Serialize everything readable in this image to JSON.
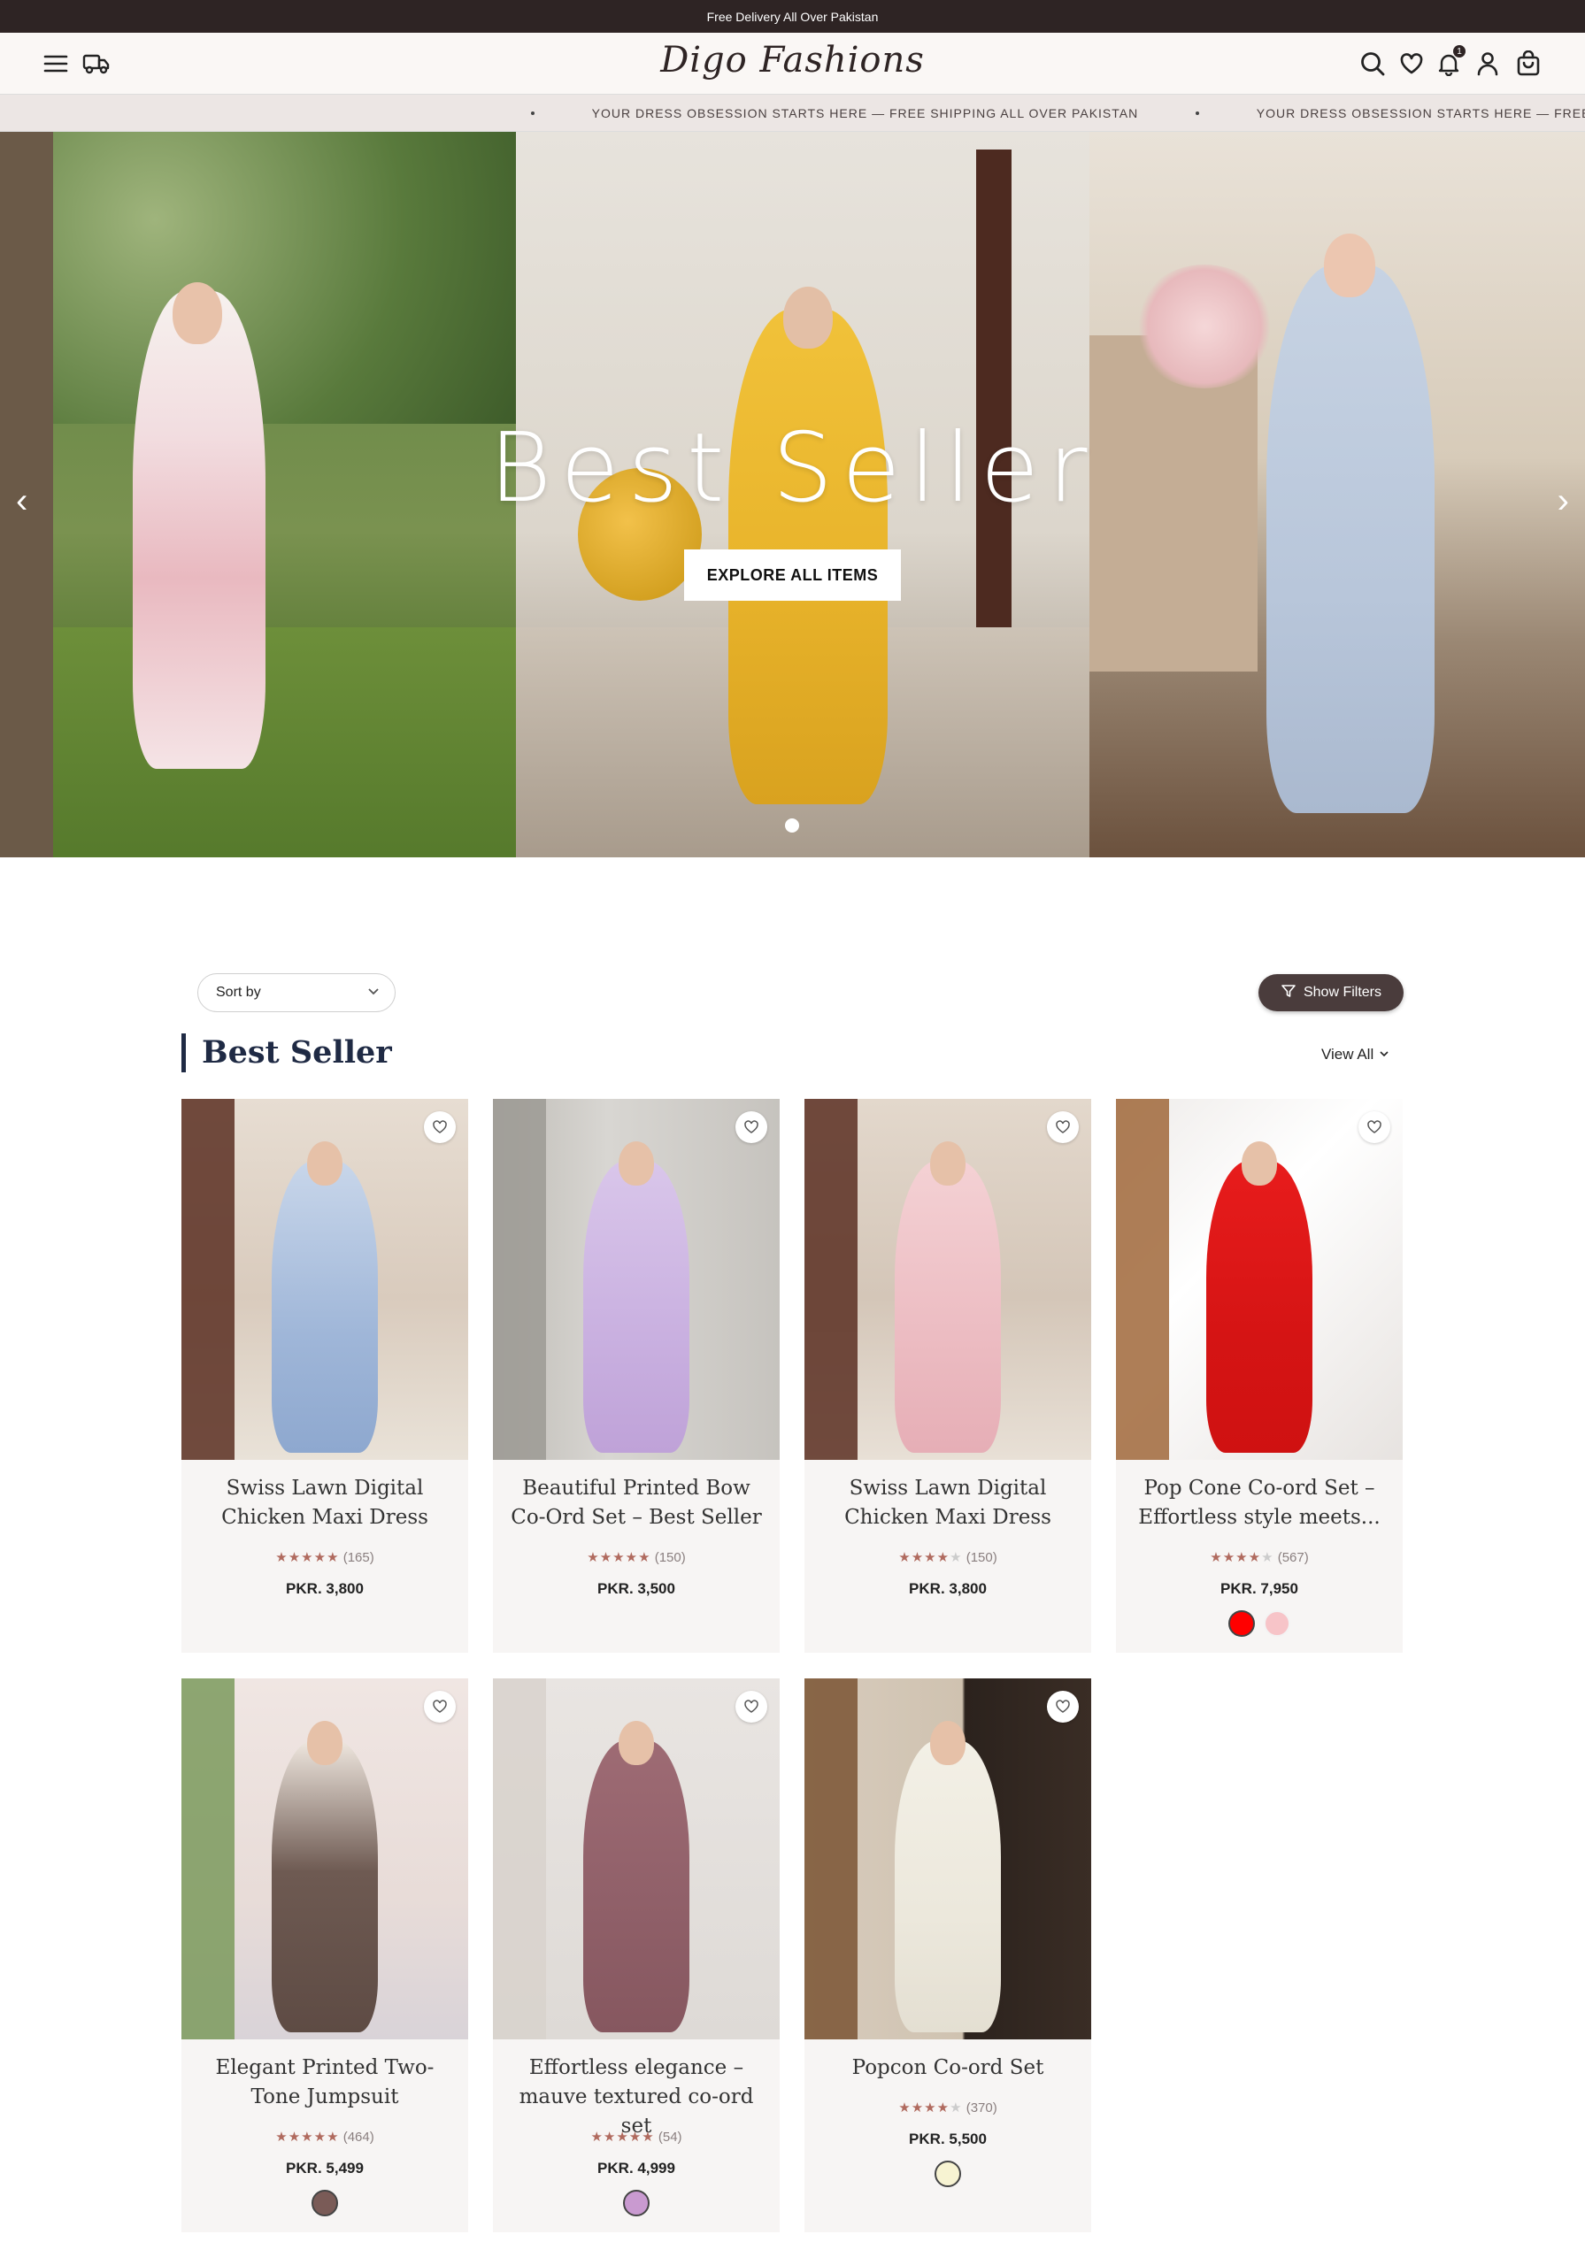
{
  "topbar": {
    "text": "Free Delivery All Over Pakistan"
  },
  "header": {
    "logo": "Digo Fashions",
    "notification_count": "1",
    "icons": [
      "menu-icon",
      "delivery-truck-icon",
      "search-icon",
      "heart-icon",
      "bell-icon",
      "user-icon",
      "cart-icon"
    ]
  },
  "marquee": {
    "text_1": "YOUR DRESS OBSESSION STARTS HERE — FREE SHIPPING ALL OVER PAKISTAN",
    "text_2": "YOUR DRESS OBSESSION STARTS HERE — FREE SHIPPING ALL OVER PAKISTAN"
  },
  "hero": {
    "title": "Best Seller",
    "button": "EXPLORE ALL ITEMS",
    "prev": "‹",
    "next": "›"
  },
  "controls": {
    "sort_label": "Sort by",
    "filters_label": "Show Filters"
  },
  "section": {
    "title": "Best Seller",
    "view_all": "View All"
  },
  "products": [
    {
      "name": "Swiss Lawn Digital Chicken Maxi Dress",
      "stars": 5,
      "reviews": "(165)",
      "price": "PKR. 3,800",
      "swatches": []
    },
    {
      "name": "Beautiful Printed Bow Co-Ord Set – Best Seller",
      "stars": 5,
      "reviews": "(150)",
      "price": "PKR. 3,500",
      "swatches": []
    },
    {
      "name": "Swiss Lawn Digital Chicken Maxi Dress",
      "stars": 4,
      "reviews": "(150)",
      "price": "PKR. 3,800",
      "swatches": []
    },
    {
      "name": "Pop Cone Co-ord Set – Effortless style meets...",
      "stars": 4,
      "reviews": "(567)",
      "price": "PKR. 7,950",
      "swatches": [
        "#ff0000",
        "#f7c4c8"
      ]
    },
    {
      "name": "Elegant Printed Two-Tone Jumpsuit",
      "stars": 5,
      "reviews": "(464)",
      "price": "PKR. 5,499",
      "swatches": [
        "#7a5b57"
      ]
    },
    {
      "name": "Effortless elegance – mauve textured co-ord set",
      "stars": 5,
      "reviews": "(54)",
      "price": "PKR. 4,999",
      "swatches": [
        "#c99ad0"
      ]
    },
    {
      "name": "Popcon Co-ord Set",
      "stars": 4,
      "reviews": "(370)",
      "price": "PKR. 5,500",
      "swatches": [
        "#f7f3d2"
      ]
    }
  ],
  "colors": {
    "brand_dark": "#2e2424",
    "title_navy": "#1f2a44",
    "star": "#b06a5e"
  }
}
